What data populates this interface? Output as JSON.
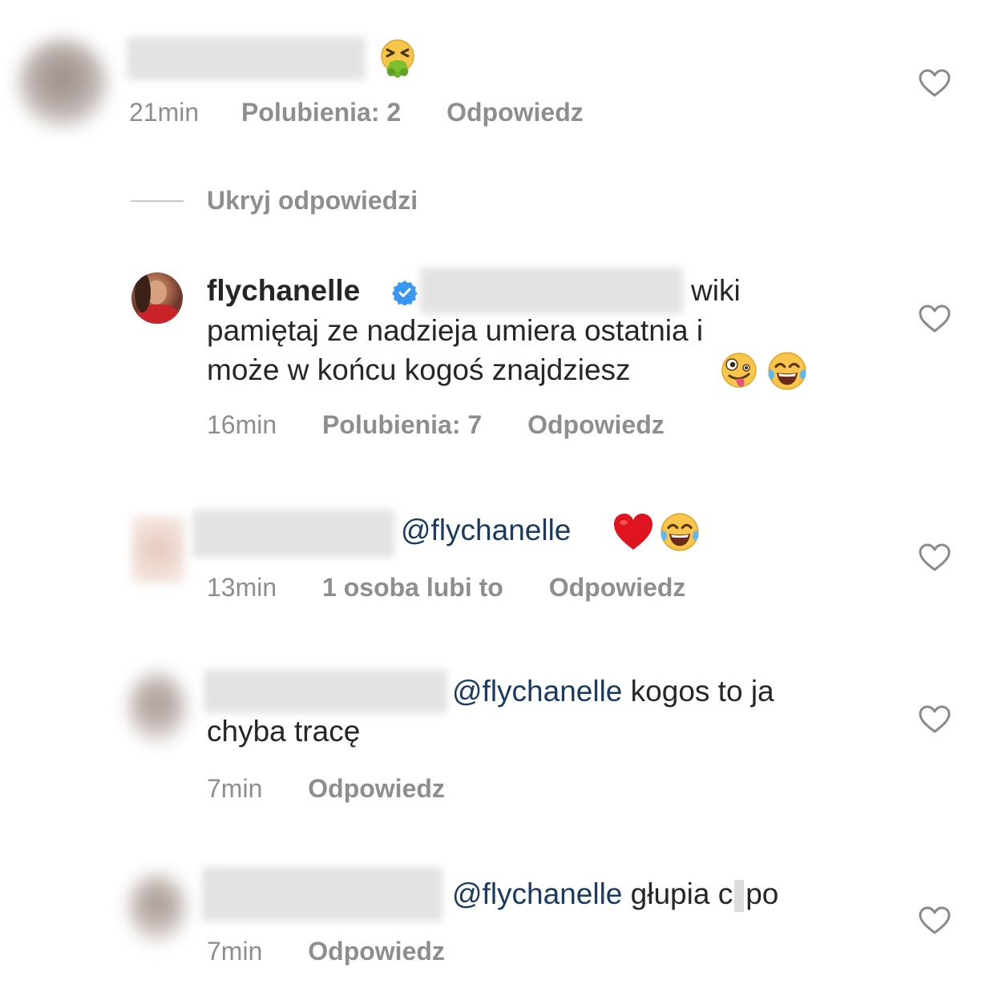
{
  "comments": [
    {
      "emoji": [
        "nauseated-face"
      ],
      "time": "21min",
      "likes": "Polubienia: 2",
      "reply": "Odpowiedz"
    },
    {
      "username": "flychanelle",
      "verified": true,
      "line1_end": "wiki",
      "line2": "pamiętaj ze nadzieja umiera ostatnia i",
      "line3": "może w końcu kogoś znajdziesz",
      "emoji": [
        "zany-face",
        "tears-of-joy"
      ],
      "time": "16min",
      "likes": "Polubienia: 7",
      "reply": "Odpowiedz"
    },
    {
      "mention": "@flychanelle",
      "emoji": [
        "red-heart",
        "tears-of-joy"
      ],
      "time": "13min",
      "likes": "1 osoba lubi to",
      "reply": "Odpowiedz"
    },
    {
      "mention": "@flychanelle",
      "text_line1": "kogos to ja",
      "text_line2": "chyba tracę",
      "time": "7min",
      "reply": "Odpowiedz"
    },
    {
      "mention": "@flychanelle",
      "text_a": "głupia c",
      "text_b": "po",
      "time": "7min",
      "reply": "Odpowiedz"
    }
  ],
  "hide_replies": "Ukryj odpowiedzi",
  "colors": {
    "text": "#262626",
    "meta": "#8e8e8e",
    "mention": "#1b3a61",
    "verified": "#3897f0"
  }
}
